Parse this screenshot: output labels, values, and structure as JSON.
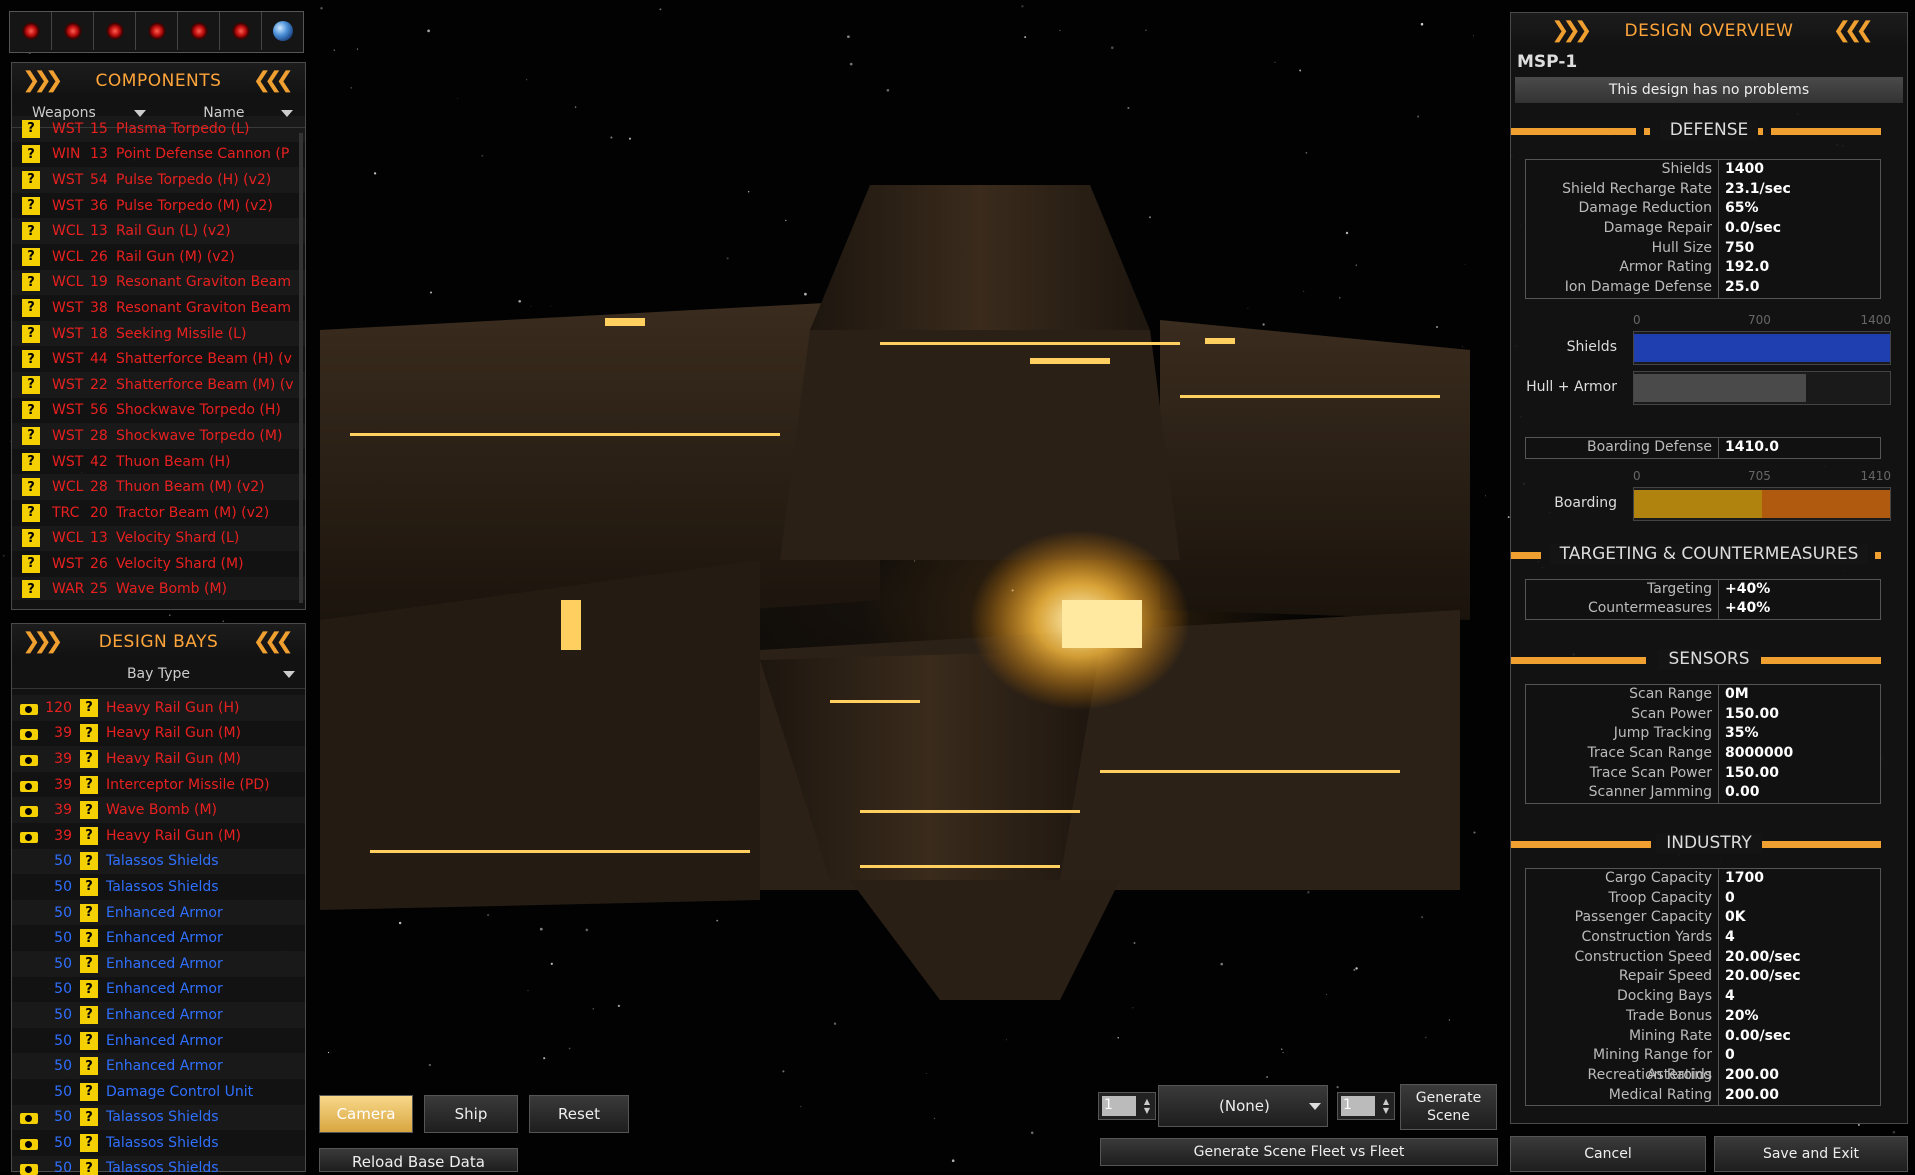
{
  "components": {
    "title": "COMPONENTS",
    "filter_category": "Weapons",
    "filter_sort": "Name",
    "items": [
      {
        "code": "WST",
        "size": "15",
        "name": "Plasma Torpedo (L)"
      },
      {
        "code": "WIN",
        "size": "13",
        "name": "Point Defense Cannon (P"
      },
      {
        "code": "WST",
        "size": "54",
        "name": "Pulse Torpedo (H) (v2)"
      },
      {
        "code": "WST",
        "size": "36",
        "name": "Pulse Torpedo (M) (v2)"
      },
      {
        "code": "WCL",
        "size": "13",
        "name": "Rail Gun (L) (v2)"
      },
      {
        "code": "WCL",
        "size": "26",
        "name": "Rail Gun (M) (v2)"
      },
      {
        "code": "WCL",
        "size": "19",
        "name": "Resonant Graviton Beam"
      },
      {
        "code": "WST",
        "size": "38",
        "name": "Resonant Graviton Beam"
      },
      {
        "code": "WST",
        "size": "18",
        "name": "Seeking Missile (L)"
      },
      {
        "code": "WST",
        "size": "44",
        "name": "Shatterforce Beam (H) (v"
      },
      {
        "code": "WST",
        "size": "22",
        "name": "Shatterforce Beam (M) (v"
      },
      {
        "code": "WST",
        "size": "56",
        "name": "Shockwave Torpedo (H)"
      },
      {
        "code": "WST",
        "size": "28",
        "name": "Shockwave Torpedo (M)"
      },
      {
        "code": "WST",
        "size": "42",
        "name": "Thuon Beam (H)"
      },
      {
        "code": "WCL",
        "size": "28",
        "name": "Thuon Beam (M) (v2)"
      },
      {
        "code": "TRC",
        "size": "20",
        "name": "Tractor Beam (M) (v2)"
      },
      {
        "code": "WCL",
        "size": "13",
        "name": "Velocity Shard (L)"
      },
      {
        "code": "WST",
        "size": "26",
        "name": "Velocity Shard (M)"
      },
      {
        "code": "WAR",
        "size": "25",
        "name": "Wave Bomb (M)"
      }
    ]
  },
  "design_bays": {
    "title": "DESIGN BAYS",
    "filter": "Bay Type",
    "items": [
      {
        "cam": true,
        "qty": "120",
        "name": "Heavy Rail Gun (H)",
        "color": "red"
      },
      {
        "cam": true,
        "qty": "39",
        "name": "Heavy Rail Gun (M)",
        "color": "red"
      },
      {
        "cam": true,
        "qty": "39",
        "name": "Heavy Rail Gun (M)",
        "color": "red"
      },
      {
        "cam": true,
        "qty": "39",
        "name": "Interceptor Missile (PD)",
        "color": "red"
      },
      {
        "cam": true,
        "qty": "39",
        "name": "Wave Bomb (M)",
        "color": "red"
      },
      {
        "cam": true,
        "qty": "39",
        "name": "Heavy Rail Gun (M)",
        "color": "red"
      },
      {
        "cam": false,
        "qty": "50",
        "name": "Talassos Shields",
        "color": "blue"
      },
      {
        "cam": false,
        "qty": "50",
        "name": "Talassos Shields",
        "color": "blue"
      },
      {
        "cam": false,
        "qty": "50",
        "name": "Enhanced Armor",
        "color": "blue"
      },
      {
        "cam": false,
        "qty": "50",
        "name": "Enhanced Armor",
        "color": "blue"
      },
      {
        "cam": false,
        "qty": "50",
        "name": "Enhanced Armor",
        "color": "blue"
      },
      {
        "cam": false,
        "qty": "50",
        "name": "Enhanced Armor",
        "color": "blue"
      },
      {
        "cam": false,
        "qty": "50",
        "name": "Enhanced Armor",
        "color": "blue"
      },
      {
        "cam": false,
        "qty": "50",
        "name": "Enhanced Armor",
        "color": "blue"
      },
      {
        "cam": false,
        "qty": "50",
        "name": "Enhanced Armor",
        "color": "blue"
      },
      {
        "cam": false,
        "qty": "50",
        "name": "Damage Control Unit",
        "color": "blue"
      },
      {
        "cam": true,
        "qty": "50",
        "name": "Talassos Shields",
        "color": "blue"
      },
      {
        "cam": true,
        "qty": "50",
        "name": "Talassos Shields",
        "color": "blue"
      },
      {
        "cam": true,
        "qty": "50",
        "name": "Talassos Shields",
        "color": "blue"
      }
    ]
  },
  "overview": {
    "title": "DESIGN OVERVIEW",
    "design_name": "MSP-1",
    "status": "This design has no problems",
    "defense": {
      "title": "DEFENSE",
      "stats": [
        {
          "k": "Shields",
          "v": "1400"
        },
        {
          "k": "Shield Recharge Rate",
          "v": "23.1/sec"
        },
        {
          "k": "Damage Reduction",
          "v": "65%"
        },
        {
          "k": "Damage Repair",
          "v": "0.0/sec"
        },
        {
          "k": "Hull Size",
          "v": "750"
        },
        {
          "k": "Armor Rating",
          "v": "192.0"
        },
        {
          "k": "Ion Damage Defense",
          "v": "25.0"
        }
      ],
      "gauge_ticks": [
        "0",
        "700",
        "1400"
      ],
      "shields_label": "Shields",
      "shields_fraction": 1.0,
      "hull_label": "Hull + Armor",
      "hull_fraction": 0.67,
      "boarding_defense_label": "Boarding Defense",
      "boarding_defense_value": "1410.0",
      "boarding_ticks": [
        "0",
        "705",
        "1410"
      ],
      "boarding_label": "Boarding",
      "boarding_fraction": 1.0
    },
    "targeting": {
      "title": "TARGETING & COUNTERMEASURES",
      "stats": [
        {
          "k": "Targeting",
          "v": "+40%"
        },
        {
          "k": "Countermeasures",
          "v": "+40%"
        }
      ]
    },
    "sensors": {
      "title": "SENSORS",
      "stats": [
        {
          "k": "Scan Range",
          "v": "0M"
        },
        {
          "k": "Scan Power",
          "v": "150.00"
        },
        {
          "k": "Jump Tracking",
          "v": "35%"
        },
        {
          "k": "Trace Scan Range",
          "v": "8000000"
        },
        {
          "k": "Trace Scan Power",
          "v": "150.00"
        },
        {
          "k": "Scanner Jamming",
          "v": "0.00"
        }
      ]
    },
    "industry": {
      "title": "INDUSTRY",
      "stats": [
        {
          "k": "Cargo Capacity",
          "v": "1700"
        },
        {
          "k": "Troop Capacity",
          "v": "0"
        },
        {
          "k": "Passenger Capacity",
          "v": "0K"
        },
        {
          "k": "Construction Yards",
          "v": "4"
        },
        {
          "k": "Construction Speed",
          "v": "20.00/sec"
        },
        {
          "k": "Repair Speed",
          "v": "20.00/sec"
        },
        {
          "k": "Docking Bays",
          "v": "4"
        },
        {
          "k": "Trade Bonus",
          "v": "20%"
        },
        {
          "k": "Mining Rate",
          "v": "0.00/sec"
        },
        {
          "k": "Mining Range for Asteroids",
          "v": "0"
        },
        {
          "k": "Recreation Rating",
          "v": "200.00"
        },
        {
          "k": "Medical Rating",
          "v": "200.00"
        }
      ]
    }
  },
  "controls": {
    "camera": "Camera",
    "ship": "Ship",
    "reset": "Reset",
    "reload": "Reload Base Data",
    "spinner_left": "1",
    "race_select": "(None)",
    "spinner_right": "1",
    "generate_scene": "Generate Scene",
    "generate_fleet": "Generate Scene Fleet vs Fleet",
    "cancel": "Cancel",
    "save_exit": "Save and Exit"
  },
  "colors": {
    "accent": "#f0a030",
    "weapon_text": "#e82020",
    "support_text": "#3070ff",
    "shields_bar": "#1f3fb0",
    "hull_bar": "#4a4a4a",
    "boarding_bar_a": "#b0820e",
    "boarding_bar_b": "#b05a10"
  }
}
